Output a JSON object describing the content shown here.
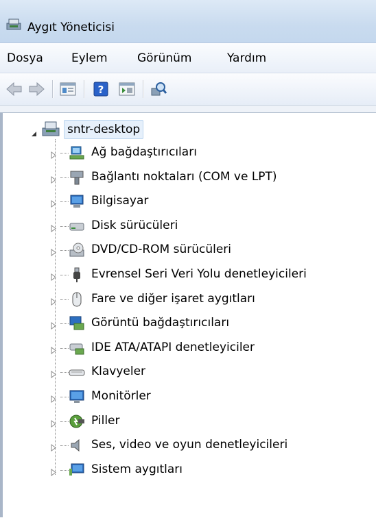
{
  "window": {
    "title": "Aygıt Yöneticisi"
  },
  "menu": [
    "Dosya",
    "Eylem",
    "Görünüm",
    "Yardım"
  ],
  "toolbar": {
    "buttons": [
      "back-arrow-icon",
      "forward-arrow-icon",
      "properties-icon",
      "help-icon",
      "show-hidden-icon",
      "scan-hardware-icon"
    ]
  },
  "tree": {
    "root": "sntr-desktop",
    "items": [
      {
        "label": "Ağ bağdaştırıcıları",
        "icon": "network-adapter-icon"
      },
      {
        "label": "Bağlantı noktaları (COM ve LPT)",
        "icon": "port-icon"
      },
      {
        "label": "Bilgisayar",
        "icon": "computer-icon"
      },
      {
        "label": "Disk sürücüleri",
        "icon": "disk-drive-icon"
      },
      {
        "label": "DVD/CD-ROM sürücüleri",
        "icon": "dvd-drive-icon"
      },
      {
        "label": "Evrensel Seri Veri Yolu denetleyicileri",
        "icon": "usb-icon"
      },
      {
        "label": "Fare ve diğer işaret aygıtları",
        "icon": "mouse-icon"
      },
      {
        "label": "Görüntü bağdaştırıcıları",
        "icon": "display-adapter-icon"
      },
      {
        "label": "IDE ATA/ATAPI denetleyiciler",
        "icon": "ide-controller-icon"
      },
      {
        "label": "Klavyeler",
        "icon": "keyboard-icon"
      },
      {
        "label": "Monitörler",
        "icon": "monitor-icon"
      },
      {
        "label": "Piller",
        "icon": "battery-icon"
      },
      {
        "label": "Ses, video ve oyun denetleyicileri",
        "icon": "speaker-icon"
      },
      {
        "label": "Sistem aygıtları",
        "icon": "system-devices-icon"
      }
    ]
  }
}
